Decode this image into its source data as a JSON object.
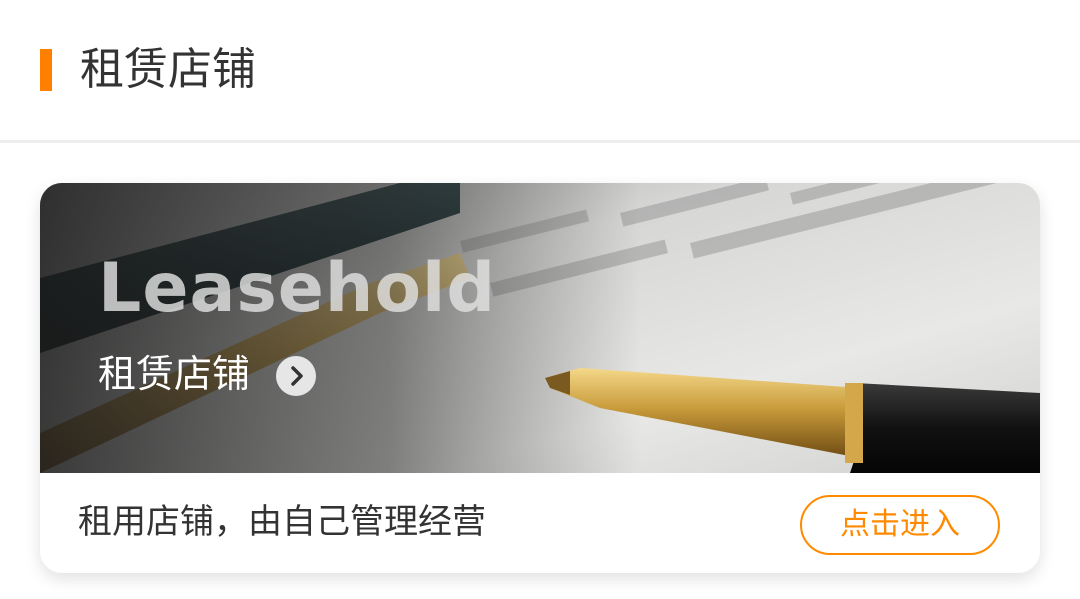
{
  "header": {
    "title": "租赁店铺",
    "accent_color": "#ff7f00"
  },
  "card": {
    "banner": {
      "title": "Leasehold",
      "subtitle": "租赁店铺",
      "arrow_icon": "chevron-right-icon",
      "image_description": "pen-on-contract-photo"
    },
    "description": "租用店铺，由自己管理经营",
    "button_label": "点击进入",
    "button_color": "#ff8a00"
  }
}
